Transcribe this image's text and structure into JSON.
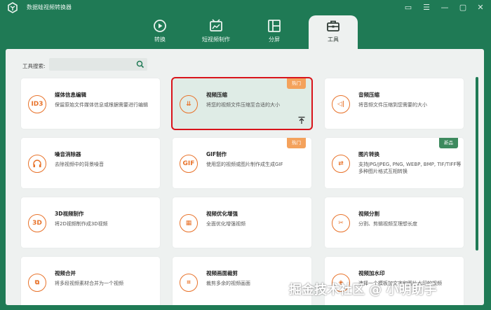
{
  "app": {
    "title": "数据蛙视频转换器"
  },
  "window_controls": {
    "chat": "▭",
    "menu": "☰",
    "minimize": "—",
    "maximize": "▢",
    "close": "✕"
  },
  "tabs": [
    {
      "label": "转换",
      "icon": "convert-icon"
    },
    {
      "label": "短视频制作",
      "icon": "short-video-icon"
    },
    {
      "label": "分屏",
      "icon": "split-screen-icon"
    },
    {
      "label": "工具",
      "icon": "toolbox-icon",
      "active": true
    }
  ],
  "search": {
    "label": "工具搜索:",
    "placeholder": ""
  },
  "tools": [
    {
      "title": "媒体信息编辑",
      "desc": "保留原始文件媒体信息或根据需要进行编辑",
      "icon_text": "ID3"
    },
    {
      "title": "视频压缩",
      "desc": "将您的视频文件压缩至合适的大小",
      "icon_text": "⇊",
      "badge": "热门"
    },
    {
      "title": "音频压缩",
      "desc": "将音频文件压缩到您需要的大小",
      "icon_text": "◁|"
    },
    {
      "title": "噪音消除器",
      "desc": "去除视频中的背景噪音",
      "icon_text": "🎧"
    },
    {
      "title": "GIF制作",
      "desc": "使用您的视频或图片制作成生成GIF",
      "icon_text": "GIF",
      "badge": "热门"
    },
    {
      "title": "图片转换",
      "desc": "支持JPG/JPEG, PNG, WEBP, BMP, TIF/TIFF等多种图片格式互相转换",
      "icon_text": "⇄",
      "badge": "新品"
    },
    {
      "title": "3D视频制作",
      "desc": "将2D视频制作成3D视频",
      "icon_text": "3D"
    },
    {
      "title": "视频优化增强",
      "desc": "全面优化增强视频",
      "icon_text": "▦"
    },
    {
      "title": "视频分割",
      "desc": "分割、剪辑视频至理想长度",
      "icon_text": "✂"
    },
    {
      "title": "视频合并",
      "desc": "将多段视频素材合并为一个视频",
      "icon_text": "⧉"
    },
    {
      "title": "视频画面裁剪",
      "desc": "裁剪多余的视频画面",
      "icon_text": "⌗"
    },
    {
      "title": "视频加水印",
      "desc": "选择一个模板加文字和图片水印的视频",
      "icon_text": "◈"
    }
  ],
  "watermark": "掘金技术社区 @ 小明助手",
  "colors": {
    "brand_green": "#1f7a55",
    "accent_orange": "#e8732b",
    "hot_badge": "#f4a25c",
    "new_badge": "#3d8a5e",
    "selection": "#d9141b"
  }
}
